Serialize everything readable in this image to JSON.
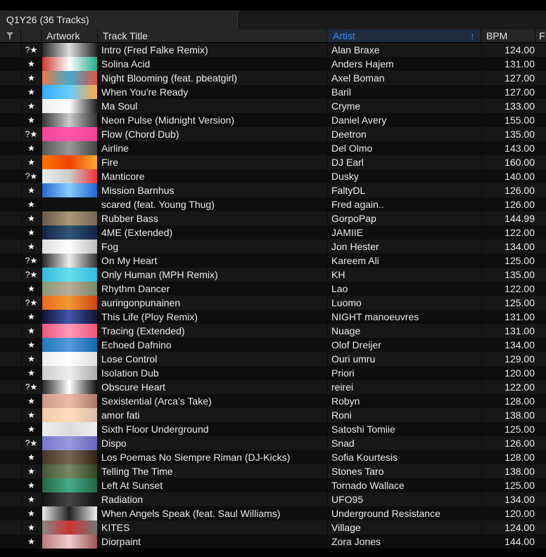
{
  "playlist": {
    "tab_label": "Q1Y26 (36 Tracks)"
  },
  "columns": {
    "artwork": "Artwork",
    "title": "Track Title",
    "artist": "Artist",
    "bpm": "BPM",
    "extra": "F",
    "sort_indicator": "↑"
  },
  "colors": {
    "accent": "#3a8ff5",
    "row_odd": "#171717",
    "row_even": "#0d0d0d"
  },
  "tracks": [
    {
      "flag": "?★",
      "title": "Intro (Fred Falke Remix)",
      "artist": "Alan Braxe",
      "bpm": "124.00",
      "art": [
        "#222",
        "#ddd",
        "#222"
      ]
    },
    {
      "flag": "★",
      "title": "Solina Acid",
      "artist": "Anders Hajem",
      "bpm": "131.00",
      "art": [
        "#c33",
        "#fff",
        "#2a8"
      ]
    },
    {
      "flag": "★",
      "title": "Night Blooming (feat. pbeatgirl)",
      "artist": "Axel Boman",
      "bpm": "127.00",
      "art": [
        "#e74",
        "#4ac",
        "#d54"
      ]
    },
    {
      "flag": "★",
      "title": "When You're Ready",
      "artist": "Baril",
      "bpm": "127.00",
      "art": [
        "#3af",
        "#6cf",
        "#fa4"
      ]
    },
    {
      "flag": "★",
      "title": "Ma Soul",
      "artist": "Cryme",
      "bpm": "133.00",
      "art": [
        "#eee",
        "#fff",
        "#222"
      ]
    },
    {
      "flag": "★",
      "title": "Neon Pulse (Midnight Version)",
      "artist": "Daniel Avery",
      "bpm": "155.00",
      "art": [
        "#333",
        "#ccc",
        "#333"
      ]
    },
    {
      "flag": "?★",
      "title": "Flow (Chord Dub)",
      "artist": "Deetron",
      "bpm": "135.00",
      "art": [
        "#e49",
        "#f5a",
        "#e49"
      ]
    },
    {
      "flag": "★",
      "title": "Airline",
      "artist": "Del Olmo",
      "bpm": "143.00",
      "art": [
        "#555",
        "#999",
        "#444"
      ]
    },
    {
      "flag": "★",
      "title": "Fire",
      "artist": "DJ Earl",
      "bpm": "160.00",
      "art": [
        "#f70",
        "#e40",
        "#fa3"
      ]
    },
    {
      "flag": "?★",
      "title": "Manticore",
      "artist": "Dusky",
      "bpm": "140.00",
      "art": [
        "#eee",
        "#ccc",
        "#e33"
      ]
    },
    {
      "flag": "★",
      "title": "Mission Barnhus",
      "artist": "FaltyDL",
      "bpm": "126.00",
      "art": [
        "#26c",
        "#8cf",
        "#26c"
      ]
    },
    {
      "flag": "★",
      "title": "scared (feat. Young Thug)",
      "artist": "Fred again..",
      "bpm": "126.00",
      "art": [
        "#111",
        "#111",
        "#111"
      ]
    },
    {
      "flag": "★",
      "title": "Rubber Bass",
      "artist": "GorpoPap",
      "bpm": "144.99",
      "art": [
        "#654",
        "#a97",
        "#765"
      ]
    },
    {
      "flag": "★",
      "title": "4ME (Extended)",
      "artist": "JAMIIE",
      "bpm": "122.00",
      "art": [
        "#124",
        "#357",
        "#124"
      ]
    },
    {
      "flag": "★",
      "title": "Fog",
      "artist": "Jon Hester",
      "bpm": "134.00",
      "art": [
        "#ddd",
        "#fff",
        "#bbb"
      ]
    },
    {
      "flag": "?★",
      "title": "On My Heart",
      "artist": "Kareem Ali",
      "bpm": "125.00",
      "art": [
        "#222",
        "#eee",
        "#333"
      ]
    },
    {
      "flag": "?★",
      "title": "Only Human (MPH Remix)",
      "artist": "KH",
      "bpm": "135.00",
      "art": [
        "#3bd",
        "#6de",
        "#3bd"
      ]
    },
    {
      "flag": "★",
      "title": "Rhythm Dancer",
      "artist": "Lao",
      "bpm": "122.00",
      "art": [
        "#897",
        "#ba9",
        "#786"
      ]
    },
    {
      "flag": "?★",
      "title": "auringonpunainen",
      "artist": "Luomo",
      "bpm": "125.00",
      "art": [
        "#e62",
        "#e93",
        "#c41"
      ]
    },
    {
      "flag": "★",
      "title": "This Life (Ploy Remix)",
      "artist": "NIGHT manoeuvres",
      "bpm": "131.00",
      "art": [
        "#113",
        "#45a",
        "#113"
      ]
    },
    {
      "flag": "★",
      "title": "Tracing (Extended)",
      "artist": "Nuage",
      "bpm": "131.00",
      "art": [
        "#e57",
        "#f9b",
        "#e57"
      ]
    },
    {
      "flag": "★",
      "title": "Echoed Dafnino",
      "artist": "Olof Dreijer",
      "bpm": "134.00",
      "art": [
        "#27b",
        "#59d",
        "#16a"
      ]
    },
    {
      "flag": "★",
      "title": "Lose Control",
      "artist": "Ouri umru",
      "bpm": "129.00",
      "art": [
        "#eee",
        "#fff",
        "#ddd"
      ]
    },
    {
      "flag": "★",
      "title": "Isolation Dub",
      "artist": "Priori",
      "bpm": "120.00",
      "art": [
        "#ccc",
        "#eee",
        "#aaa"
      ]
    },
    {
      "flag": "?★",
      "title": "Obscure Heart",
      "artist": "reirei",
      "bpm": "122.00",
      "art": [
        "#222",
        "#fff",
        "#111"
      ]
    },
    {
      "flag": "★",
      "title": "Sexistential (Arca’s Take)",
      "artist": "Robyn",
      "bpm": "128.00",
      "art": [
        "#c98",
        "#eba",
        "#a76"
      ]
    },
    {
      "flag": "★",
      "title": "amor fati",
      "artist": "Roni",
      "bpm": "138.00",
      "art": [
        "#eca",
        "#fdb",
        "#dba"
      ]
    },
    {
      "flag": "★",
      "title": "Sixth Floor Underground",
      "artist": "Satoshi Tomiie",
      "bpm": "125.00",
      "art": [
        "#eee",
        "#ddd",
        "#eee"
      ]
    },
    {
      "flag": "?★",
      "title": "Dispo",
      "artist": "Snad",
      "bpm": "126.00",
      "art": [
        "#77c",
        "#99d",
        "#66b"
      ]
    },
    {
      "flag": "★",
      "title": "Los Poemas No Siempre Riman (DJ-Kicks)",
      "artist": "Sofia Kourtesis",
      "bpm": "128.00",
      "art": [
        "#432",
        "#765",
        "#321"
      ]
    },
    {
      "flag": "★",
      "title": "Telling The Time",
      "artist": "Stones Taro",
      "bpm": "138.00",
      "art": [
        "#453",
        "#786",
        "#342"
      ]
    },
    {
      "flag": "★",
      "title": "Left At Sunset",
      "artist": "Tornado Wallace",
      "bpm": "125.00",
      "art": [
        "#264",
        "#4a8",
        "#264"
      ]
    },
    {
      "flag": "★",
      "title": "Radiation",
      "artist": "UFO95",
      "bpm": "134.00",
      "art": [
        "#111",
        "#444",
        "#111"
      ]
    },
    {
      "flag": "★",
      "title": "When Angels Speak (feat. Saul Williams)",
      "artist": "Underground Resistance",
      "bpm": "120.00",
      "art": [
        "#eee",
        "#222",
        "#eee"
      ]
    },
    {
      "flag": "★",
      "title": "KITES",
      "artist": "Village",
      "bpm": "124.00",
      "art": [
        "#888",
        "#c33",
        "#777"
      ]
    },
    {
      "flag": "★",
      "title": "Diorpaint",
      "artist": "Zora Jones",
      "bpm": "144.00",
      "art": [
        "#b77",
        "#ecc",
        "#955"
      ]
    }
  ]
}
